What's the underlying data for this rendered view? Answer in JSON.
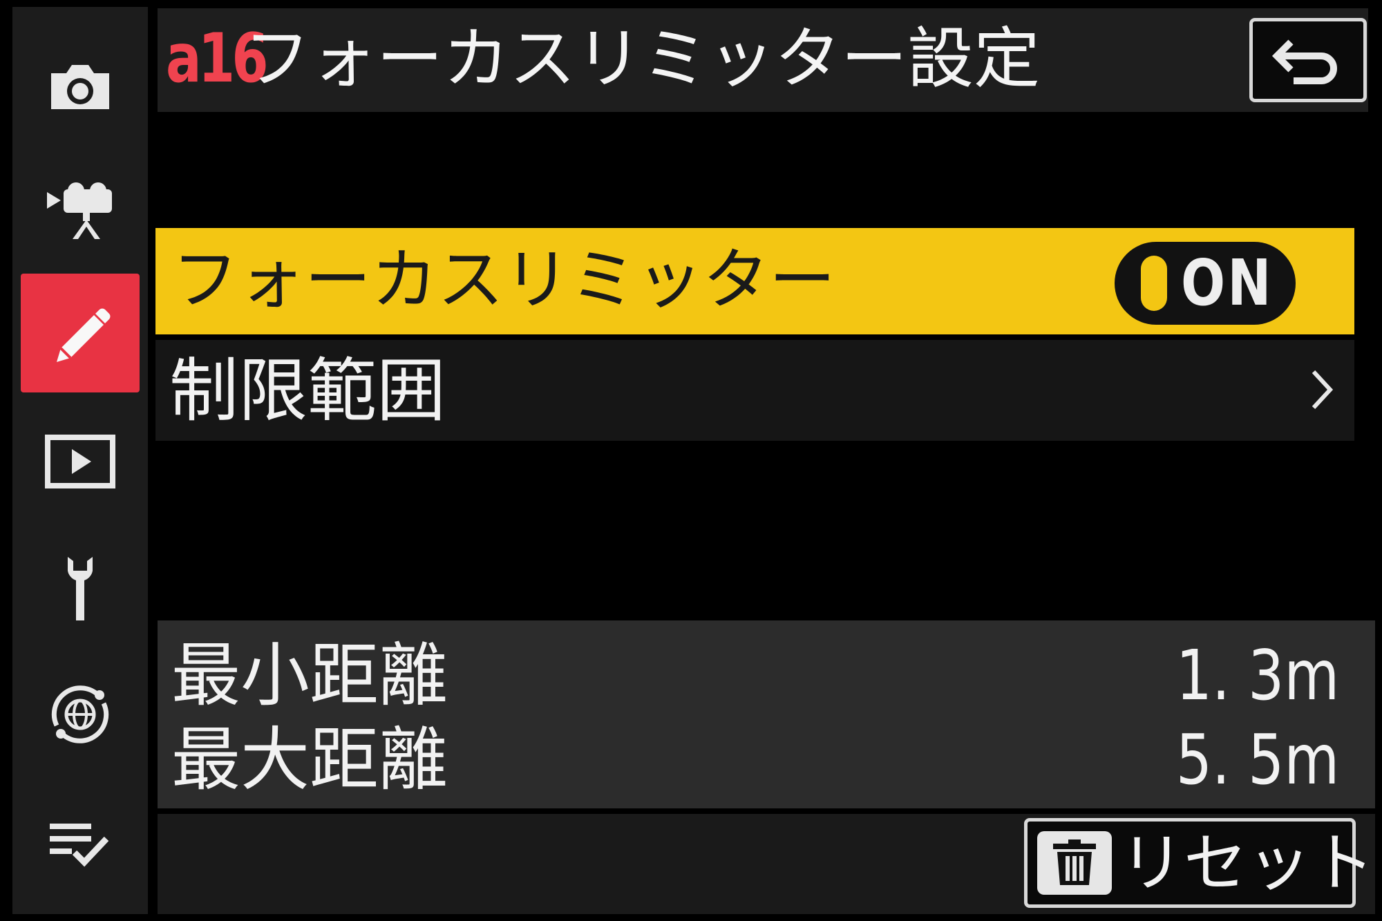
{
  "sidebar": {
    "items": [
      {
        "icon": "camera-icon",
        "active": false
      },
      {
        "icon": "movie-camera-icon",
        "active": false
      },
      {
        "icon": "pencil-icon",
        "active": true
      },
      {
        "icon": "playback-icon",
        "active": false
      },
      {
        "icon": "wrench-icon",
        "active": false
      },
      {
        "icon": "network-globe-icon",
        "active": false
      },
      {
        "icon": "my-menu-icon",
        "active": false
      }
    ]
  },
  "header": {
    "code": "a16",
    "title": "フォーカスリミッター設定",
    "back_icon": "back-arrow-icon"
  },
  "menu": {
    "focus_limiter": {
      "label": "フォーカスリミッター",
      "state": "ON"
    },
    "limit_range": {
      "label": "制限範囲"
    }
  },
  "distances": {
    "min": {
      "label": "最小距離",
      "value": "1. 3m"
    },
    "max": {
      "label": "最大距離",
      "value": "5. 5m"
    }
  },
  "footer": {
    "reset_icon": "trash-icon",
    "reset_label": "リセット"
  },
  "colors": {
    "highlight": "#f3c613",
    "accent_red": "#e83343",
    "code_red": "#f0434f",
    "background": "#000000"
  }
}
